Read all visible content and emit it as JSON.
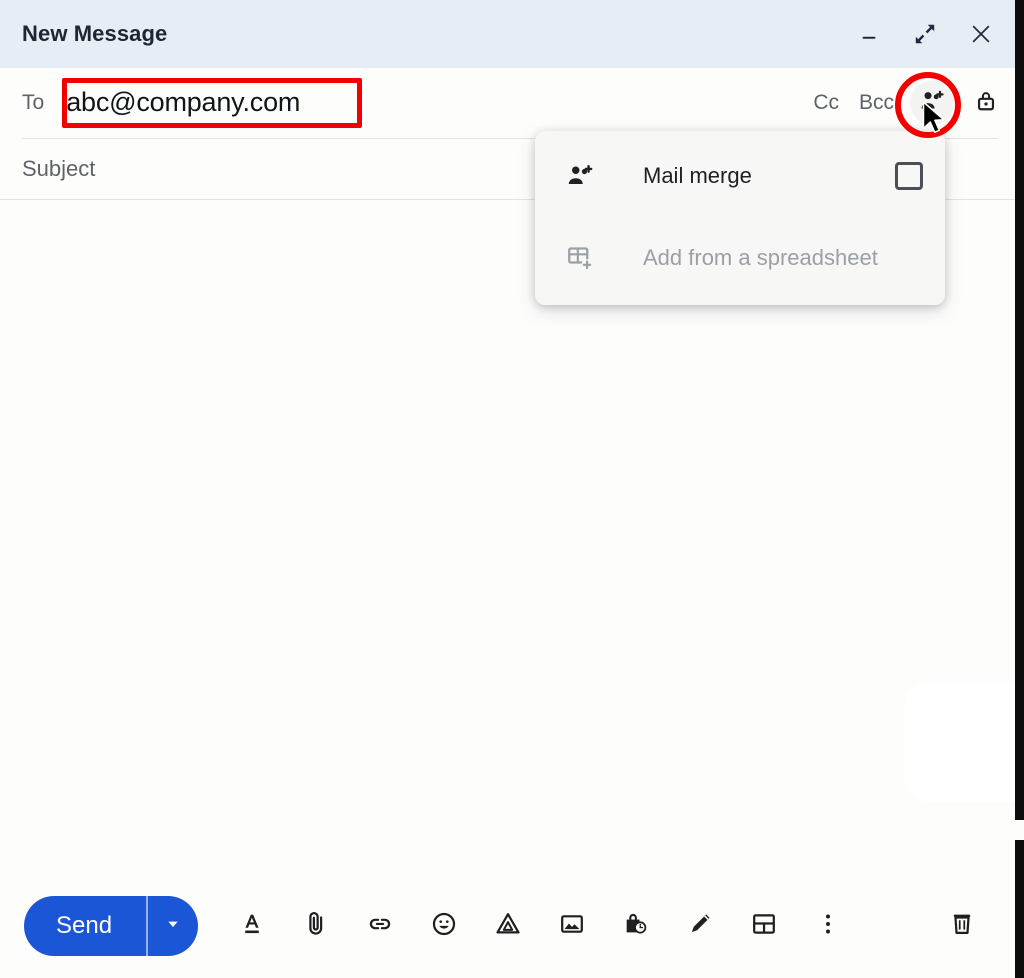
{
  "window": {
    "title": "New Message",
    "controls": [
      {
        "name": "minimize",
        "icon": "minimize-icon"
      },
      {
        "name": "expand",
        "icon": "expand-icon"
      },
      {
        "name": "close",
        "icon": "close-icon"
      }
    ]
  },
  "recipients": {
    "to_label": "To",
    "to_value": "abc@company.com",
    "cc_label": "Cc",
    "bcc_label": "Bcc",
    "merge_icon": "person-add-icon",
    "lock_icon": "lock-icon"
  },
  "subject": {
    "placeholder": "Subject",
    "value": ""
  },
  "body": {
    "value": ""
  },
  "dropdown": {
    "visible": true,
    "items": [
      {
        "label": "Mail merge",
        "icon": "person-add-icon",
        "has_checkbox": true,
        "checked": false,
        "disabled": false
      },
      {
        "label": "Add from a spreadsheet",
        "icon": "spreadsheet-add-icon",
        "has_checkbox": false,
        "checked": false,
        "disabled": true
      }
    ]
  },
  "toolbar": {
    "send_label": "Send",
    "send_caret_icon": "chevron-down-icon",
    "icons": [
      {
        "name": "formatting-options-icon",
        "title": "Formatting options"
      },
      {
        "name": "attach-file-icon",
        "title": "Attach files"
      },
      {
        "name": "insert-link-icon",
        "title": "Insert link"
      },
      {
        "name": "insert-emoji-icon",
        "title": "Insert emoji"
      },
      {
        "name": "insert-drive-icon",
        "title": "Insert files using Drive"
      },
      {
        "name": "insert-photo-icon",
        "title": "Insert photo"
      },
      {
        "name": "confidential-mode-icon",
        "title": "Toggle confidential mode"
      },
      {
        "name": "insert-signature-icon",
        "title": "Insert signature"
      },
      {
        "name": "layout-icon",
        "title": "Layout"
      },
      {
        "name": "more-options-icon",
        "title": "More options"
      }
    ],
    "trash_icon": "trash-icon",
    "trash_title": "Discard draft"
  },
  "annotations": {
    "highlight_color": "#f40000",
    "recipient_box": true,
    "merge_button_circle": true,
    "cursor_visible": true
  },
  "colors": {
    "titlebar_bg": "#e6edf4",
    "send_blue": "#1a56d6",
    "menu_bg": "#f7f7f5",
    "text_primary": "#202124",
    "text_secondary": "#5f6368",
    "text_disabled": "#9aa0a6",
    "annotation_red": "#f40000"
  }
}
